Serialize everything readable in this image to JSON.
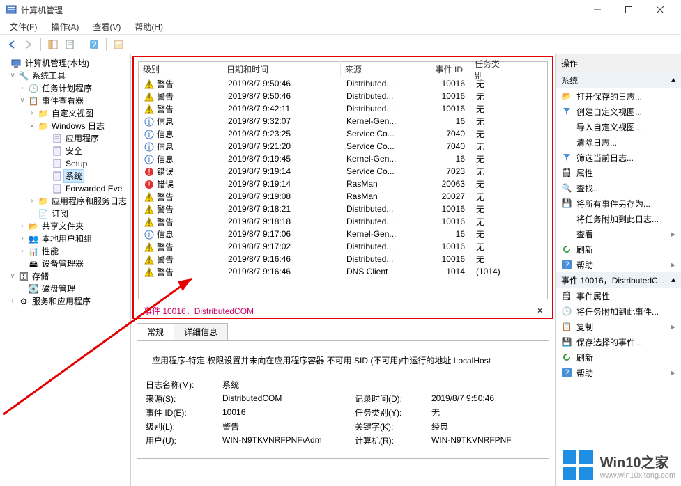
{
  "window": {
    "title": "计算机管理"
  },
  "menu": {
    "file": "文件(F)",
    "action": "操作(A)",
    "view": "查看(V)",
    "help": "帮助(H)"
  },
  "tree": {
    "root": "计算机管理(本地)",
    "system_tools": "系统工具",
    "task_scheduler": "任务计划程序",
    "event_viewer": "事件查看器",
    "custom_views": "自定义视图",
    "windows_logs": "Windows 日志",
    "application": "应用程序",
    "security": "安全",
    "setup": "Setup",
    "system": "系统",
    "forwarded": "Forwarded Eve",
    "app_service_logs": "应用程序和服务日志",
    "subscriptions": "订阅",
    "shared_folders": "共享文件夹",
    "local_users": "本地用户和组",
    "performance": "性能",
    "device_mgr": "设备管理器",
    "storage": "存储",
    "disk_mgmt": "磁盘管理",
    "services_apps": "服务和应用程序"
  },
  "columns": {
    "level": "级别",
    "datetime": "日期和时间",
    "source": "来源",
    "event_id": "事件 ID",
    "task": "任务类别"
  },
  "events": [
    {
      "level": "警告",
      "lv": "w",
      "dt": "2019/8/7 9:50:46",
      "src": "Distributed...",
      "id": "10016",
      "task": "无"
    },
    {
      "level": "警告",
      "lv": "w",
      "dt": "2019/8/7 9:50:46",
      "src": "Distributed...",
      "id": "10016",
      "task": "无"
    },
    {
      "level": "警告",
      "lv": "w",
      "dt": "2019/8/7 9:42:11",
      "src": "Distributed...",
      "id": "10016",
      "task": "无"
    },
    {
      "level": "信息",
      "lv": "i",
      "dt": "2019/8/7 9:32:07",
      "src": "Kernel-Gen...",
      "id": "16",
      "task": "无"
    },
    {
      "level": "信息",
      "lv": "i",
      "dt": "2019/8/7 9:23:25",
      "src": "Service Co...",
      "id": "7040",
      "task": "无"
    },
    {
      "level": "信息",
      "lv": "i",
      "dt": "2019/8/7 9:21:20",
      "src": "Service Co...",
      "id": "7040",
      "task": "无"
    },
    {
      "level": "信息",
      "lv": "i",
      "dt": "2019/8/7 9:19:45",
      "src": "Kernel-Gen...",
      "id": "16",
      "task": "无"
    },
    {
      "level": "错误",
      "lv": "e",
      "dt": "2019/8/7 9:19:14",
      "src": "Service Co...",
      "id": "7023",
      "task": "无"
    },
    {
      "level": "错误",
      "lv": "e",
      "dt": "2019/8/7 9:19:14",
      "src": "RasMan",
      "id": "20063",
      "task": "无"
    },
    {
      "level": "警告",
      "lv": "w",
      "dt": "2019/8/7 9:19:08",
      "src": "RasMan",
      "id": "20027",
      "task": "无"
    },
    {
      "level": "警告",
      "lv": "w",
      "dt": "2019/8/7 9:18:21",
      "src": "Distributed...",
      "id": "10016",
      "task": "无"
    },
    {
      "level": "警告",
      "lv": "w",
      "dt": "2019/8/7 9:18:18",
      "src": "Distributed...",
      "id": "10016",
      "task": "无"
    },
    {
      "level": "信息",
      "lv": "i",
      "dt": "2019/8/7 9:17:06",
      "src": "Kernel-Gen...",
      "id": "16",
      "task": "无"
    },
    {
      "level": "警告",
      "lv": "w",
      "dt": "2019/8/7 9:17:02",
      "src": "Distributed...",
      "id": "10016",
      "task": "无"
    },
    {
      "level": "警告",
      "lv": "w",
      "dt": "2019/8/7 9:16:46",
      "src": "Distributed...",
      "id": "10016",
      "task": "无"
    },
    {
      "level": "警告",
      "lv": "w",
      "dt": "2019/8/7 9:16:46",
      "src": "DNS Client",
      "id": "1014",
      "task": "(1014)"
    }
  ],
  "event_title": "事件 10016，DistributedCOM",
  "tabs": {
    "general": "常规",
    "details": "详细信息"
  },
  "detail_msg": "应用程序-特定 权限设置并未向在应用程序容器 不可用 SID (不可用)中运行的地址 LocalHost",
  "detail": {
    "log_name_k": "日志名称(M):",
    "log_name_v": "系统",
    "source_k": "来源(S):",
    "source_v": "DistributedCOM",
    "logged_k": "记录时间(D):",
    "logged_v": "2019/8/7 9:50:46",
    "event_id_k": "事件 ID(E):",
    "event_id_v": "10016",
    "task_k": "任务类别(Y):",
    "task_v": "无",
    "level_k": "级别(L):",
    "level_v": "警告",
    "keywords_k": "关键字(K):",
    "keywords_v": "经典",
    "user_k": "用户(U):",
    "user_v": "WIN-N9TKVNRFPNF\\Adm",
    "computer_k": "计算机(R):",
    "computer_v": "WIN-N9TKVNRFPNF"
  },
  "actions": {
    "header": "操作",
    "section1": "系统",
    "open_saved": "打开保存的日志...",
    "create_custom": "创建自定义视图...",
    "import_custom": "导入自定义视图...",
    "clear_log": "清除日志...",
    "filter_log": "筛选当前日志...",
    "properties": "属性",
    "find": "查找...",
    "save_all": "将所有事件另存为...",
    "attach_task": "将任务附加到此日志...",
    "view": "查看",
    "refresh": "刷新",
    "help": "帮助",
    "section2": "事件 10016，DistributedC...",
    "event_props": "事件属性",
    "attach_event_task": "将任务附加到此事件...",
    "copy": "复制",
    "save_selected": "保存选择的事件...",
    "refresh2": "刷新",
    "help2": "帮助"
  },
  "watermark": {
    "text1": "Win10之家",
    "text2": "www.win10xitong.com"
  }
}
